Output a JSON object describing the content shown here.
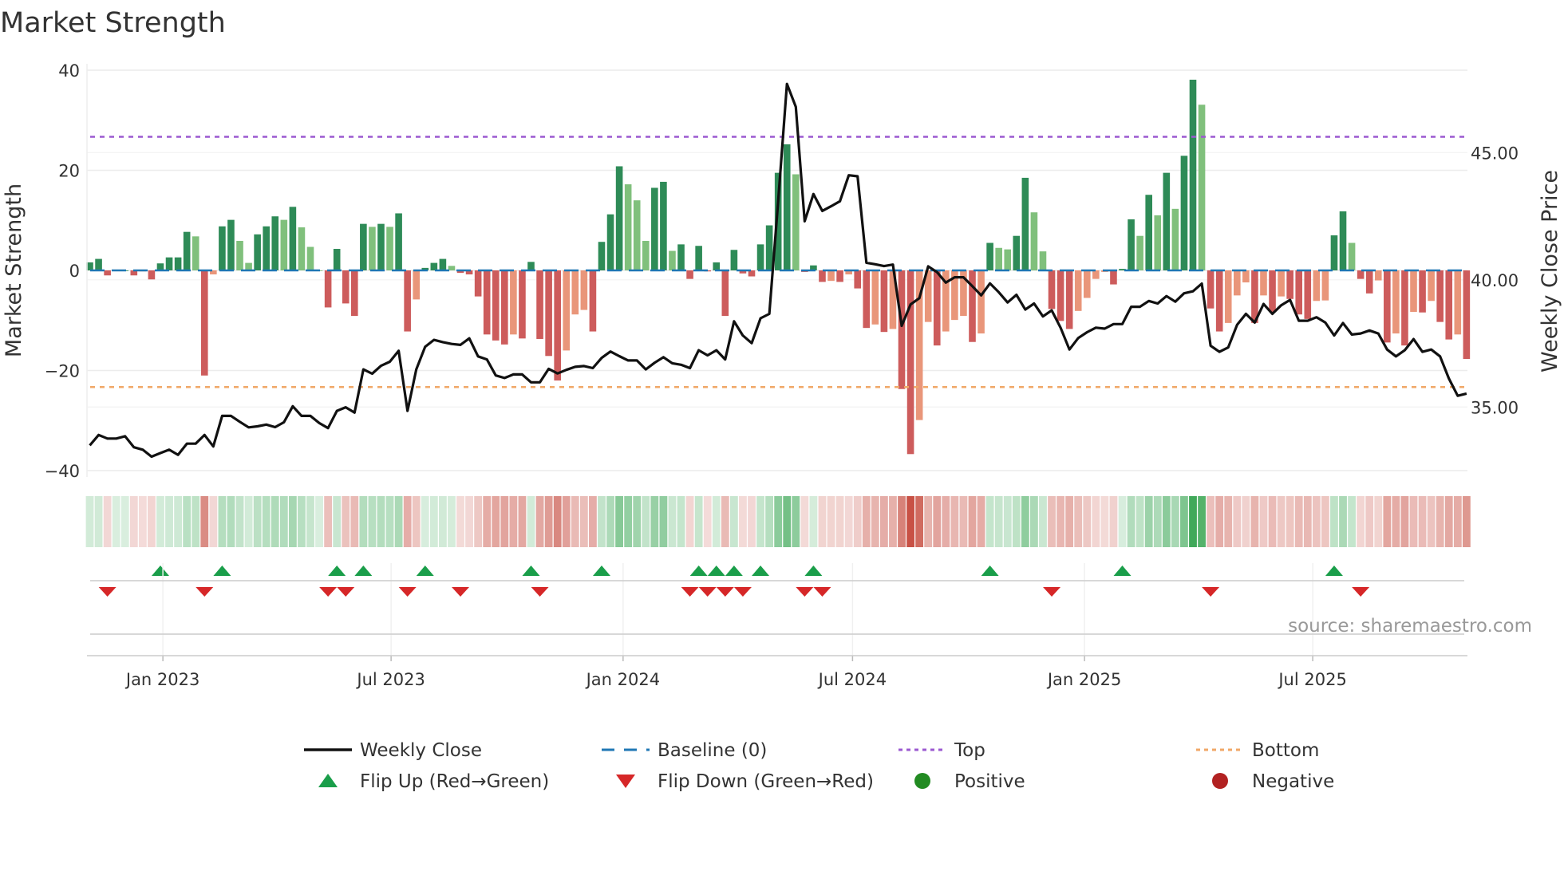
{
  "chart_data": {
    "type": "bar+line",
    "title": "Market Strength",
    "ylabel_left": "Market Strength",
    "ylabel_right": "Weekly Close Price",
    "ylim_left": [
      -40,
      40
    ],
    "ylim_right": [
      32.5,
      48.24
    ],
    "left_ticks": [
      40,
      20,
      0,
      -20,
      -40
    ],
    "left_tick_labels": [
      "40",
      "20",
      "0",
      "−20",
      "−40"
    ],
    "right_ticks": [
      45,
      40,
      35
    ],
    "right_tick_labels": [
      "45.00",
      "40.00",
      "35.00"
    ],
    "x_start": "2022-11-04",
    "x_step_days": 7,
    "x_ticks": [
      {
        "label": "Jan 2023",
        "date": "2023-01-01"
      },
      {
        "label": "Jul 2023",
        "date": "2023-07-01"
      },
      {
        "label": "Jan 2024",
        "date": "2024-01-01"
      },
      {
        "label": "Jul 2024",
        "date": "2024-07-01"
      },
      {
        "label": "Jan 2025",
        "date": "2025-01-01"
      },
      {
        "label": "Jul 2025",
        "date": "2025-07-01"
      }
    ],
    "top_level": 26.7,
    "bottom_level": -23.3,
    "baseline": 0,
    "strength": [
      1.6,
      2.3,
      -1.0,
      0,
      0,
      -1.0,
      -0.2,
      -1.8,
      1.4,
      2.6,
      2.6,
      7.7,
      6.8,
      -21,
      -0.8,
      8.8,
      10.1,
      5.9,
      1.5,
      7.2,
      8.8,
      10.8,
      10.1,
      12.7,
      8.6,
      4.7,
      0,
      -7.4,
      4.3,
      -6.6,
      -9.1,
      9.3,
      8.7,
      9.3,
      8.7,
      11.4,
      -12.2,
      -5.8,
      0.5,
      1.5,
      2.3,
      0.9,
      -0.5,
      -0.8,
      -5.2,
      -12.8,
      -14,
      -14.8,
      -12.8,
      -13.6,
      1.7,
      -13.7,
      -17.1,
      -22,
      -16,
      -8.8,
      -7.9,
      -12.2,
      5.7,
      11.2,
      20.8,
      17.2,
      14,
      5.9,
      16.5,
      17.7,
      3.9,
      5.2,
      -1.7,
      4.9,
      -0.2,
      1.6,
      -9.1,
      4.1,
      -0.6,
      -1.2,
      5.2,
      9.0,
      19.5,
      25.2,
      19.2,
      -0.3,
      1.0,
      -2.3,
      -2.1,
      -2.3,
      -0.8,
      -3.6,
      -11.5,
      -10.8,
      -12.3,
      -11.7,
      -23.7,
      -36.7,
      -29.9,
      -10.3,
      -15,
      -12.2,
      -9.9,
      -9.1,
      -14.3,
      -12.6,
      5.5,
      4.5,
      4.2,
      6.9,
      18.5,
      11.6,
      3.8,
      -7.7,
      -10.1,
      -11.7,
      -8.1,
      -5.5,
      -1.7,
      -0.3,
      -2.8,
      0.3,
      10.2,
      6.9,
      15.1,
      11.0,
      19.5,
      12.3,
      22.9,
      38.1,
      33.1,
      -7.6,
      -12.2,
      -10.5,
      -5.0,
      -2.4,
      -10.5,
      -5.0,
      -8.3,
      -5.2,
      -5.7,
      -8.8,
      -9.7,
      -6.1,
      -6.0,
      7.0,
      11.8,
      5.5,
      -1.7,
      -4.6,
      -2.0,
      -14.4,
      -12.6,
      -15,
      -8.3,
      -8.4,
      -6.1,
      -10.3,
      -13.8,
      -12.8,
      -17.7
    ],
    "weekly_close": [
      33.49,
      33.9,
      33.76,
      33.76,
      33.85,
      33.42,
      33.32,
      33.05,
      33.19,
      33.32,
      33.12,
      33.56,
      33.56,
      33.9,
      33.45,
      34.65,
      34.65,
      34.42,
      34.2,
      34.24,
      34.31,
      34.21,
      34.4,
      35.03,
      34.65,
      34.65,
      34.37,
      34.17,
      34.85,
      34.99,
      34.78,
      36.48,
      36.31,
      36.62,
      36.78,
      37.21,
      34.85,
      36.48,
      37.37,
      37.64,
      37.55,
      37.48,
      37.44,
      37.7,
      36.99,
      36.87,
      36.24,
      36.14,
      36.28,
      36.28,
      35.97,
      35.97,
      36.5,
      36.32,
      36.46,
      36.58,
      36.61,
      36.53,
      36.93,
      37.18,
      37.0,
      36.83,
      36.83,
      36.48,
      36.74,
      36.96,
      36.72,
      36.66,
      36.53,
      37.23,
      37.03,
      37.23,
      36.87,
      38.37,
      37.81,
      37.51,
      38.49,
      38.66,
      43.09,
      47.7,
      46.8,
      42.3,
      43.37,
      42.71,
      42.89,
      43.09,
      44.11,
      44.07,
      40.67,
      40.61,
      40.54,
      40.6,
      38.19,
      39.03,
      39.28,
      40.53,
      40.3,
      39.89,
      40.1,
      40.1,
      39.75,
      39.39,
      39.86,
      39.51,
      39.11,
      39.41,
      38.83,
      39.07,
      38.56,
      38.8,
      38.12,
      37.26,
      37.71,
      37.94,
      38.12,
      38.08,
      38.26,
      38.26,
      38.94,
      38.94,
      39.17,
      39.07,
      39.36,
      39.14,
      39.47,
      39.55,
      39.85,
      37.41,
      37.17,
      37.34,
      38.23,
      38.66,
      38.32,
      39.05,
      38.66,
      39.0,
      39.21,
      38.39,
      38.39,
      38.53,
      38.32,
      37.81,
      38.3,
      37.85,
      37.89,
      38.01,
      37.89,
      37.26,
      36.99,
      37.23,
      37.67,
      37.17,
      37.26,
      36.99,
      36.12,
      35.44,
      35.53
    ],
    "flip_up_weeks": [
      8,
      15,
      28,
      31,
      38,
      50,
      58,
      69,
      71,
      73,
      76,
      82,
      102,
      117,
      141
    ],
    "flip_down_weeks": [
      2,
      13,
      27,
      29,
      36,
      42,
      51,
      68,
      70,
      72,
      74,
      81,
      83,
      109,
      127,
      144
    ],
    "legend_position": "bottom",
    "legend": [
      {
        "label": "Weekly Close",
        "kind": "line-solid",
        "color": "#111111"
      },
      {
        "label": "Baseline (0)",
        "kind": "line-dashed",
        "color": "#1f77b4"
      },
      {
        "label": "Top",
        "kind": "line-dotted",
        "color": "#9b59d0"
      },
      {
        "label": "Bottom",
        "kind": "line-dotted",
        "color": "#f0a868"
      },
      {
        "label": "Flip Up (Red→Green)",
        "kind": "triangle-up",
        "color": "#1a9e4a"
      },
      {
        "label": "Flip Down (Green→Red)",
        "kind": "triangle-down",
        "color": "#d62728"
      },
      {
        "label": "Positive",
        "kind": "circle",
        "color": "#228b22"
      },
      {
        "label": "Negative",
        "kind": "circle",
        "color": "#b22222"
      }
    ],
    "source": "source: sharemaestro.com",
    "colors": {
      "pos_strong": "#2e8b57",
      "pos_weak": "#80c07c",
      "neg_strong": "#cd5c5c",
      "neg_weak": "#e9967a",
      "heat_pos": "#2ca048",
      "heat_neg": "#c0392b",
      "grid": "#ececec",
      "axis": "#cccccc"
    }
  }
}
